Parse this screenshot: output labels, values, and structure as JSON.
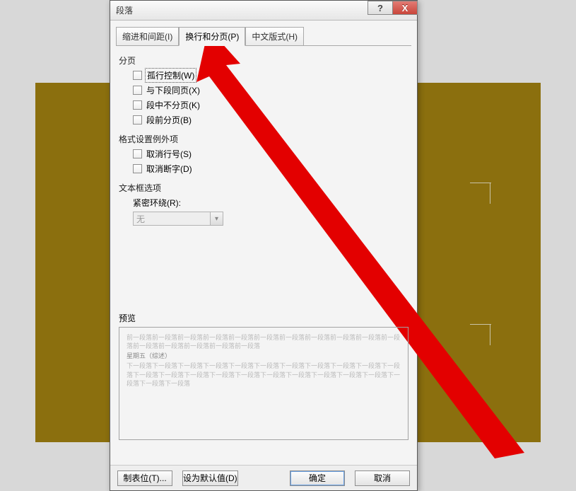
{
  "dialog": {
    "title": "段落",
    "help_symbol": "?",
    "close_symbol": "X"
  },
  "tabs": {
    "indent": "缩进和间距(I)",
    "linebreak": "换行和分页(P)",
    "chinese": "中文版式(H)"
  },
  "sections": {
    "paging": {
      "label": "分页",
      "widow": "孤行控制(W)",
      "keep_next": "与下段同页(X)",
      "keep_lines": "段中不分页(K)",
      "page_before": "段前分页(B)"
    },
    "format_except": {
      "label": "格式设置例外项",
      "no_lineno": "取消行号(S)",
      "no_hyphen": "取消断字(D)"
    },
    "textbox": {
      "label": "文本框选项",
      "tight_wrap_label": "紧密环绕(R):",
      "select_value": "无"
    },
    "preview": {
      "label": "预览",
      "faint1": "前一段落前一段落前一段落前一段落前一段落前一段落前一段落前一段落前一段落前一段落前一段落前一段落前一段落前一段落前一段落前一段落",
      "bold": "星期五（综述）",
      "faint2": "下一段落下一段落下一段落下一段落下一段落下一段落下一段落下一段落下一段落下一段落下一段落下一段落下一段落下一段落下一段落下一段落下一段落下一段落下一段落下一段落下一段落下一段落下一段落下一段落"
    }
  },
  "buttons": {
    "tabstops": "制表位(T)...",
    "set_default": "设为默认值(D)",
    "ok": "确定",
    "cancel": "取消"
  }
}
